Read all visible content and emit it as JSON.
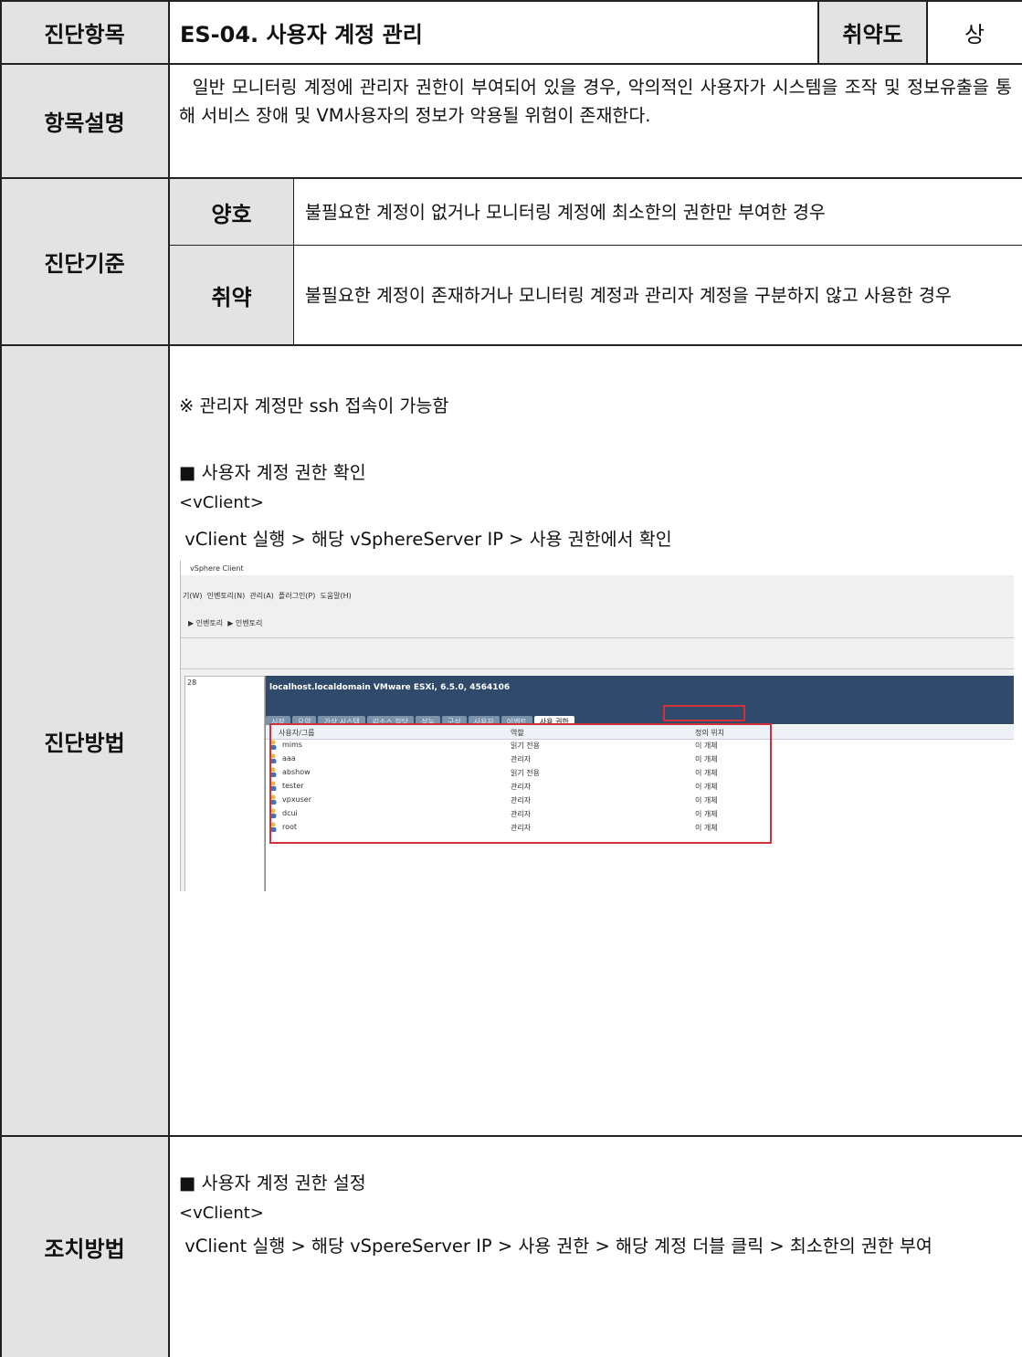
{
  "header": {
    "label_item": "진단항목",
    "title": "ES-04. 사용자 계정 관리",
    "label_severity": "취약도",
    "severity": "상"
  },
  "description": {
    "label": "항목설명",
    "text": "  일반 모니터링 계정에 관리자 권한이 부여되어 있을 경우, 악의적인 사용자가 시스템을 조작 및 정보유출을 통해 서비스 장애 및 VM사용자의 정보가 악용될 위험이 존재한다."
  },
  "criteria": {
    "label": "진단기준",
    "good_label": "양호",
    "good_text": "불필요한 계정이 없거나 모니터링 계정에 최소한의 권한만 부여한 경우",
    "bad_label": "취약",
    "bad_text": "불필요한 계정이 존재하거나 모니터링 계정과 관리자 계정을 구분하지 않고 사용한 경우"
  },
  "method": {
    "label": "진단방법",
    "note": "※ 관리자 계정만 ssh 접속이 가능함",
    "bullet": "■ 사용자 계정 권한 확인",
    "client": "<vClient>",
    "path": " vClient 실행 > 해당 vSphereServer IP > 사용 권한에서 확인",
    "screenshot": {
      "window_title": "vSphere Client",
      "menu": "기(W)  인벤토리(N)  관리(A)  플러그인(P)  도움말(H)",
      "breadcrumb": "▶ 인벤토리  ▶ 인벤토리",
      "left_num": "28",
      "host_title": "localhost.localdomain VMware ESXi, 6.5.0, 4564106",
      "tabs": [
        "시작",
        "요약",
        "가상 시스템",
        "리소스 할당",
        "성능",
        "구성",
        "사용자",
        "이벤트"
      ],
      "active_tab": "사용 권한",
      "columns": [
        "사용자/그룹",
        "역할",
        "정의 위치"
      ],
      "rows": [
        {
          "user": "mims",
          "role": "읽기 전용",
          "where": "이 개체"
        },
        {
          "user": "aaa",
          "role": "관리자",
          "where": "이 개체"
        },
        {
          "user": "abshow",
          "role": "읽기 전용",
          "where": "이 개체"
        },
        {
          "user": "tester",
          "role": "관리자",
          "where": "이 개체"
        },
        {
          "user": "vpxuser",
          "role": "관리자",
          "where": "이 개체"
        },
        {
          "user": "dcui",
          "role": "관리자",
          "where": "이 개체"
        },
        {
          "user": "root",
          "role": "관리자",
          "where": "이 개체"
        }
      ]
    }
  },
  "action": {
    "label": "조치방법",
    "bullet": "■ 사용자 계정 권한 설정",
    "client": "<vClient>",
    "path": " vClient 실행 > 해당 vSpereServer IP > 사용 권한 > 해당 계정 더블 클릭 > 최소한의 권한 부여"
  },
  "colors": {
    "header_bg": "#e3e3e3",
    "border": "#222222",
    "highlight": "#d0303a",
    "host_bar": "#2f4a6a"
  }
}
